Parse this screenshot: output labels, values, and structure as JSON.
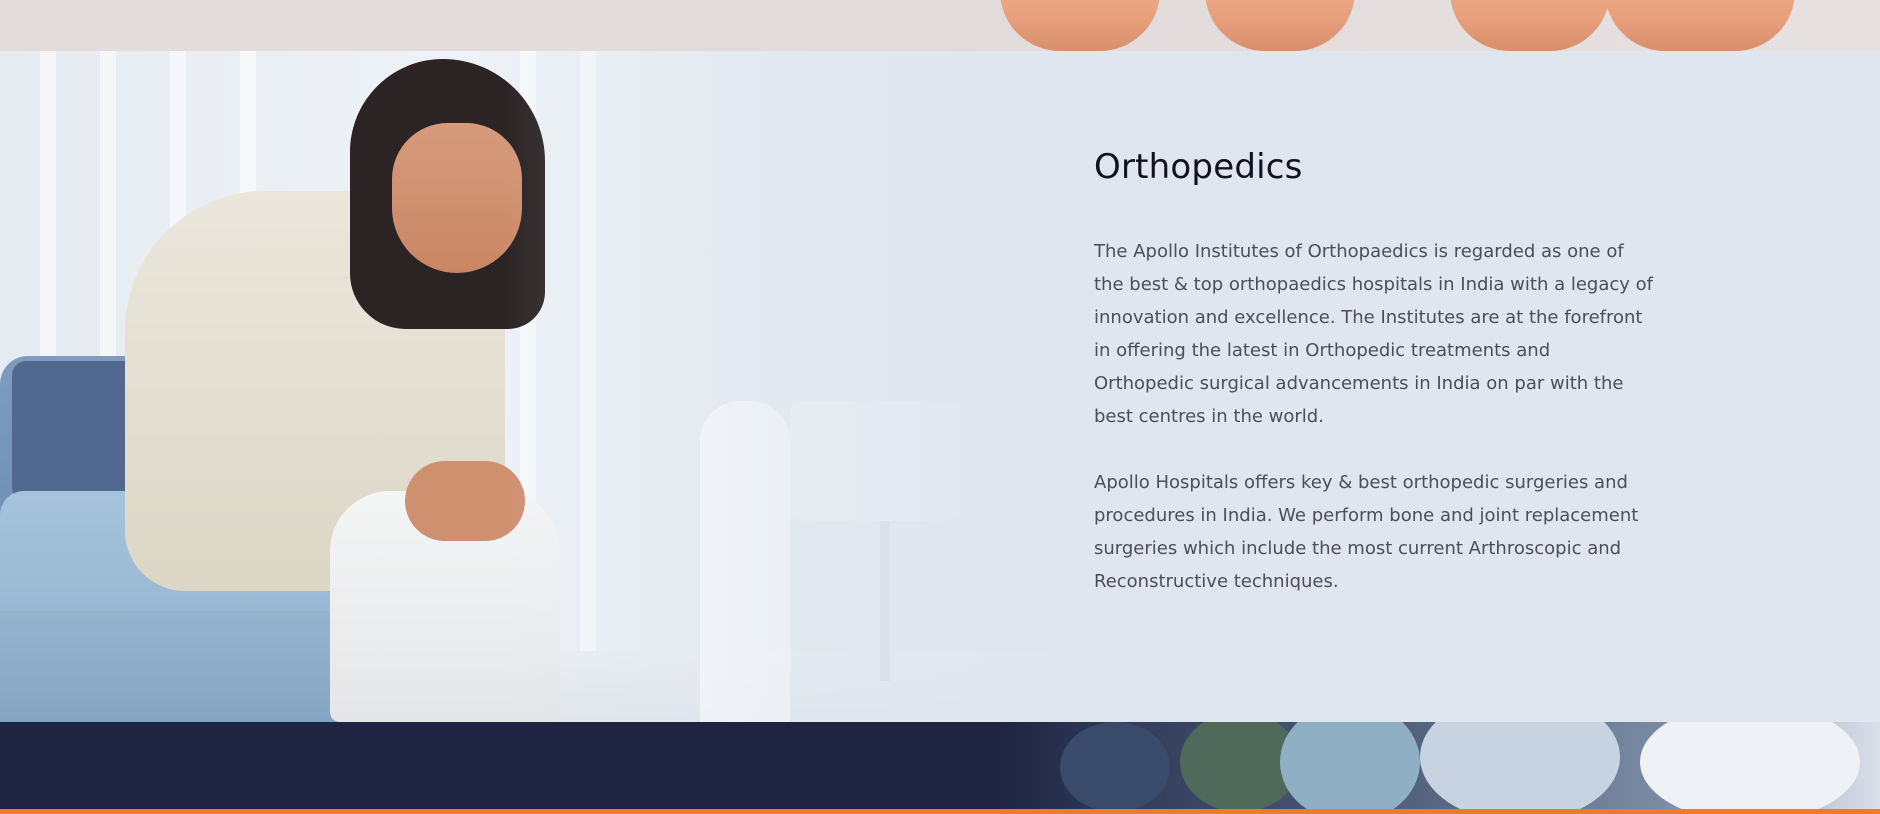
{
  "section": {
    "title": "Orthopedics",
    "paragraphs": [
      "The Apollo Institutes of Orthopaedics is regarded as one of the best & top orthopaedics hospitals in India with a legacy of innovation and excellence. The Institutes are at the forefront in offering the latest in Orthopedic treatments and Orthopedic surgical advancements in India on par with the best centres in the world.",
      "Apollo Hospitals offers key & best orthopedic surgeries and procedures in India. We perform bone and joint replacement surgeries which include the most current Arthroscopic and Reconstructive techniques."
    ]
  },
  "colors": {
    "section_bg": "#dfe6ef",
    "title": "#0f1220",
    "body_text": "#4a4f5a",
    "bottom_bg": "#1e2442",
    "accent_bar": "#f07a2a"
  }
}
